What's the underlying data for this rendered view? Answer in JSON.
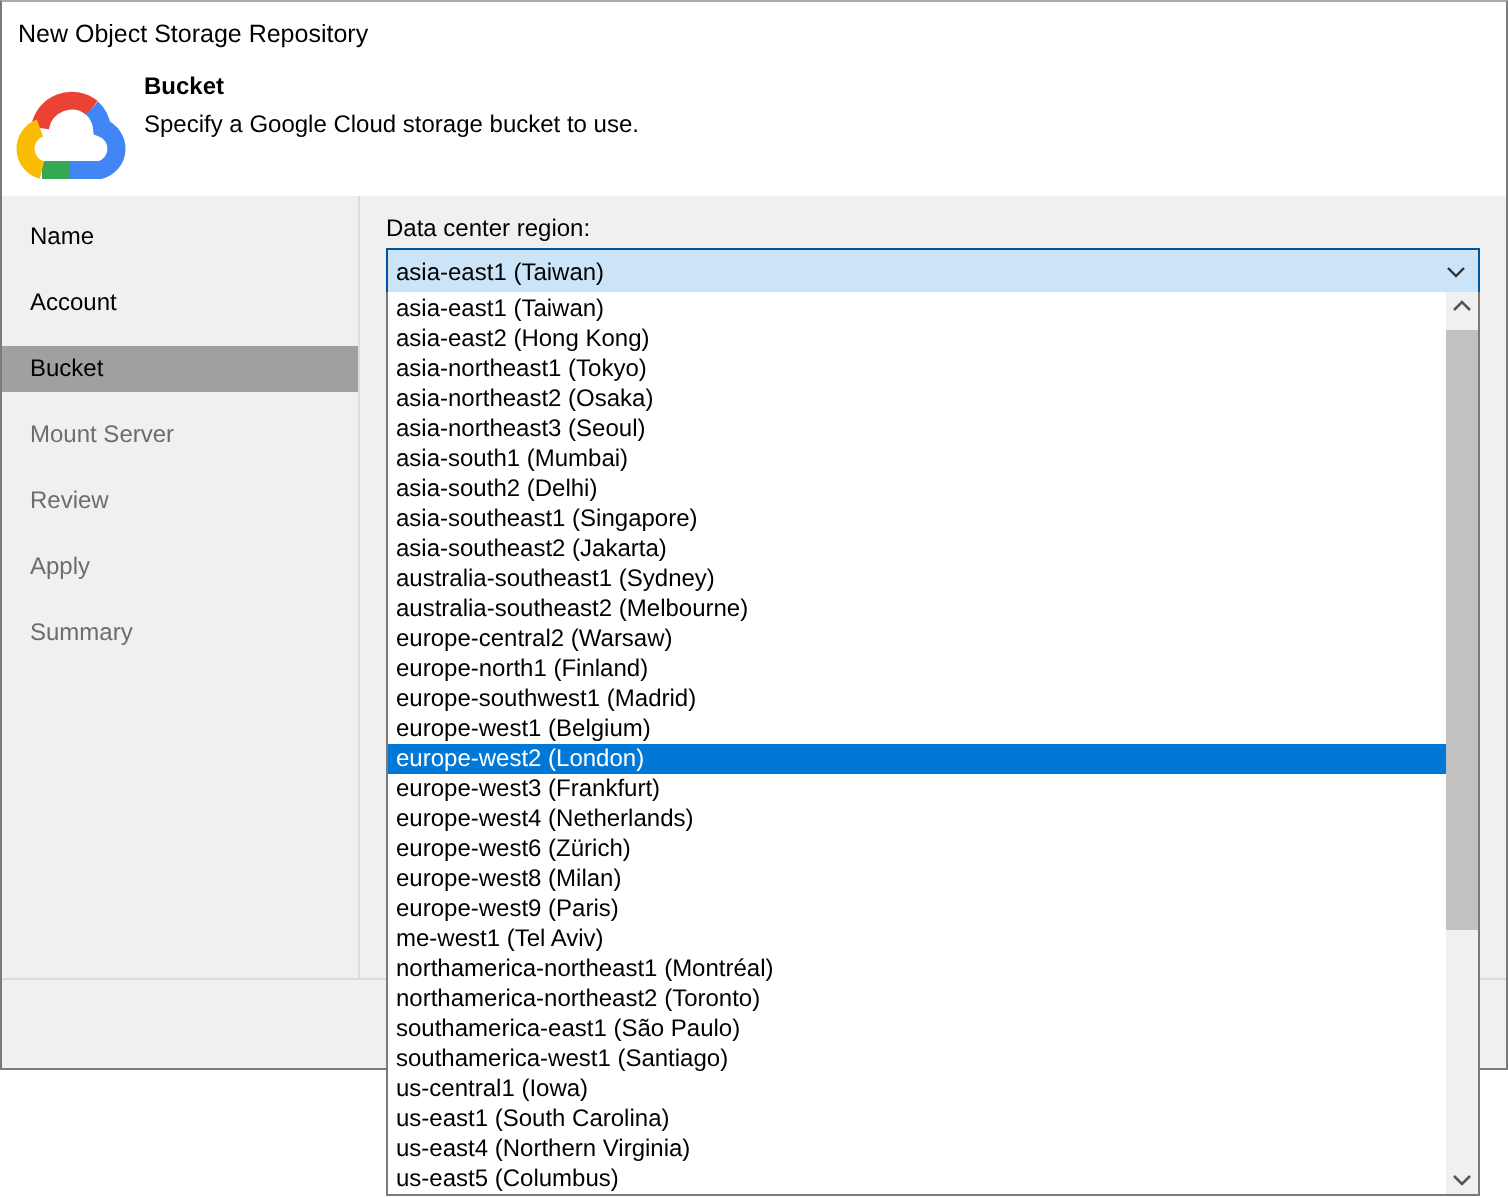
{
  "window": {
    "title": "New Object Storage Repository"
  },
  "header": {
    "title": "Bucket",
    "subtitle": "Specify a Google Cloud storage bucket to use."
  },
  "sidebar": {
    "items": [
      {
        "label": "Name",
        "selected": false,
        "enabled": true
      },
      {
        "label": "Account",
        "selected": false,
        "enabled": true
      },
      {
        "label": "Bucket",
        "selected": true,
        "enabled": true
      },
      {
        "label": "Mount Server",
        "selected": false,
        "enabled": false
      },
      {
        "label": "Review",
        "selected": false,
        "enabled": false
      },
      {
        "label": "Apply",
        "selected": false,
        "enabled": false
      },
      {
        "label": "Summary",
        "selected": false,
        "enabled": false
      }
    ]
  },
  "region": {
    "label": "Data center region:",
    "value": "asia-east1 (Taiwan)",
    "expanded": true,
    "options": [
      {
        "label": "asia-east1 (Taiwan)",
        "highlighted": false
      },
      {
        "label": "asia-east2 (Hong Kong)",
        "highlighted": false
      },
      {
        "label": "asia-northeast1 (Tokyo)",
        "highlighted": false
      },
      {
        "label": "asia-northeast2 (Osaka)",
        "highlighted": false
      },
      {
        "label": "asia-northeast3 (Seoul)",
        "highlighted": false
      },
      {
        "label": "asia-south1 (Mumbai)",
        "highlighted": false
      },
      {
        "label": "asia-south2 (Delhi)",
        "highlighted": false
      },
      {
        "label": "asia-southeast1 (Singapore)",
        "highlighted": false
      },
      {
        "label": "asia-southeast2 (Jakarta)",
        "highlighted": false
      },
      {
        "label": "australia-southeast1 (Sydney)",
        "highlighted": false
      },
      {
        "label": "australia-southeast2 (Melbourne)",
        "highlighted": false
      },
      {
        "label": "europe-central2 (Warsaw)",
        "highlighted": false
      },
      {
        "label": "europe-north1 (Finland)",
        "highlighted": false
      },
      {
        "label": "europe-southwest1 (Madrid)",
        "highlighted": false
      },
      {
        "label": "europe-west1 (Belgium)",
        "highlighted": false
      },
      {
        "label": "europe-west2 (London)",
        "highlighted": true
      },
      {
        "label": "europe-west3 (Frankfurt)",
        "highlighted": false
      },
      {
        "label": "europe-west4 (Netherlands)",
        "highlighted": false
      },
      {
        "label": "europe-west6 (Zürich)",
        "highlighted": false
      },
      {
        "label": "europe-west8 (Milan)",
        "highlighted": false
      },
      {
        "label": "europe-west9 (Paris)",
        "highlighted": false
      },
      {
        "label": "me-west1 (Tel Aviv)",
        "highlighted": false
      },
      {
        "label": "northamerica-northeast1 (Montréal)",
        "highlighted": false
      },
      {
        "label": "northamerica-northeast2 (Toronto)",
        "highlighted": false
      },
      {
        "label": "southamerica-east1 (São Paulo)",
        "highlighted": false
      },
      {
        "label": "southamerica-west1 (Santiago)",
        "highlighted": false
      },
      {
        "label": "us-central1 (Iowa)",
        "highlighted": false
      },
      {
        "label": "us-east1 (South Carolina)",
        "highlighted": false
      },
      {
        "label": "us-east4 (Northern Virginia)",
        "highlighted": false
      },
      {
        "label": "us-east5 (Columbus)",
        "highlighted": false
      }
    ]
  }
}
